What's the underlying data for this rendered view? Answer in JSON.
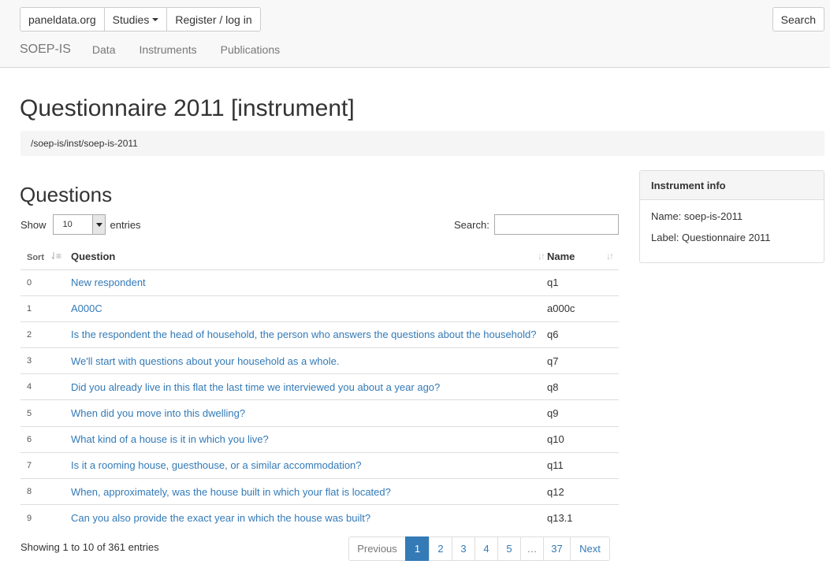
{
  "header": {
    "buttons": [
      {
        "label": "paneldata.org"
      },
      {
        "label": "Studies"
      },
      {
        "label": "Register / log in"
      }
    ],
    "search_label": "Search",
    "brand": "SOEP-IS",
    "nav": [
      "Data",
      "Instruments",
      "Publications"
    ]
  },
  "page": {
    "title": "Questionnaire 2011 [instrument]",
    "breadcrumb": "/soep-is/inst/soep-is-2011"
  },
  "questions": {
    "title": "Questions",
    "length": {
      "show_label": "Show",
      "value": "10",
      "entries_label": "entries"
    },
    "search_label": "Search:",
    "search_value": "",
    "columns": {
      "sort": "Sort",
      "question": "Question",
      "name": "Name"
    },
    "rows": [
      {
        "sort": "0",
        "question": "New respondent",
        "name": "q1"
      },
      {
        "sort": "1",
        "question": "A000C",
        "name": "a000c"
      },
      {
        "sort": "2",
        "question": "Is the respondent the head of household, the person who answers the questions about the household?",
        "name": "q6"
      },
      {
        "sort": "3",
        "question": "We'll start with questions about your household as a whole.",
        "name": "q7"
      },
      {
        "sort": "4",
        "question": "Did you already live in this flat the last time we interviewed you about a year ago?",
        "name": "q8"
      },
      {
        "sort": "5",
        "question": "When did you move into this dwelling?",
        "name": "q9"
      },
      {
        "sort": "6",
        "question": "What kind of a house is it in which you live?",
        "name": "q10"
      },
      {
        "sort": "7",
        "question": "Is it a rooming house, guesthouse, or a similar accommodation?",
        "name": "q11"
      },
      {
        "sort": "8",
        "question": "When, approximately, was the house built in which your flat is located?",
        "name": "q12"
      },
      {
        "sort": "9",
        "question": "Can you also provide the exact year in which the house was built?",
        "name": "q13.1"
      }
    ],
    "info": "Showing 1 to 10 of 361 entries",
    "pagination": {
      "previous": "Previous",
      "pages": [
        "1",
        "2",
        "3",
        "4",
        "5",
        "…",
        "37"
      ],
      "active": "1",
      "next": "Next"
    }
  },
  "instrument_info": {
    "title": "Instrument info",
    "name_line": "Name: soep-is-2011",
    "label_line": "Label: Questionnaire 2011"
  }
}
